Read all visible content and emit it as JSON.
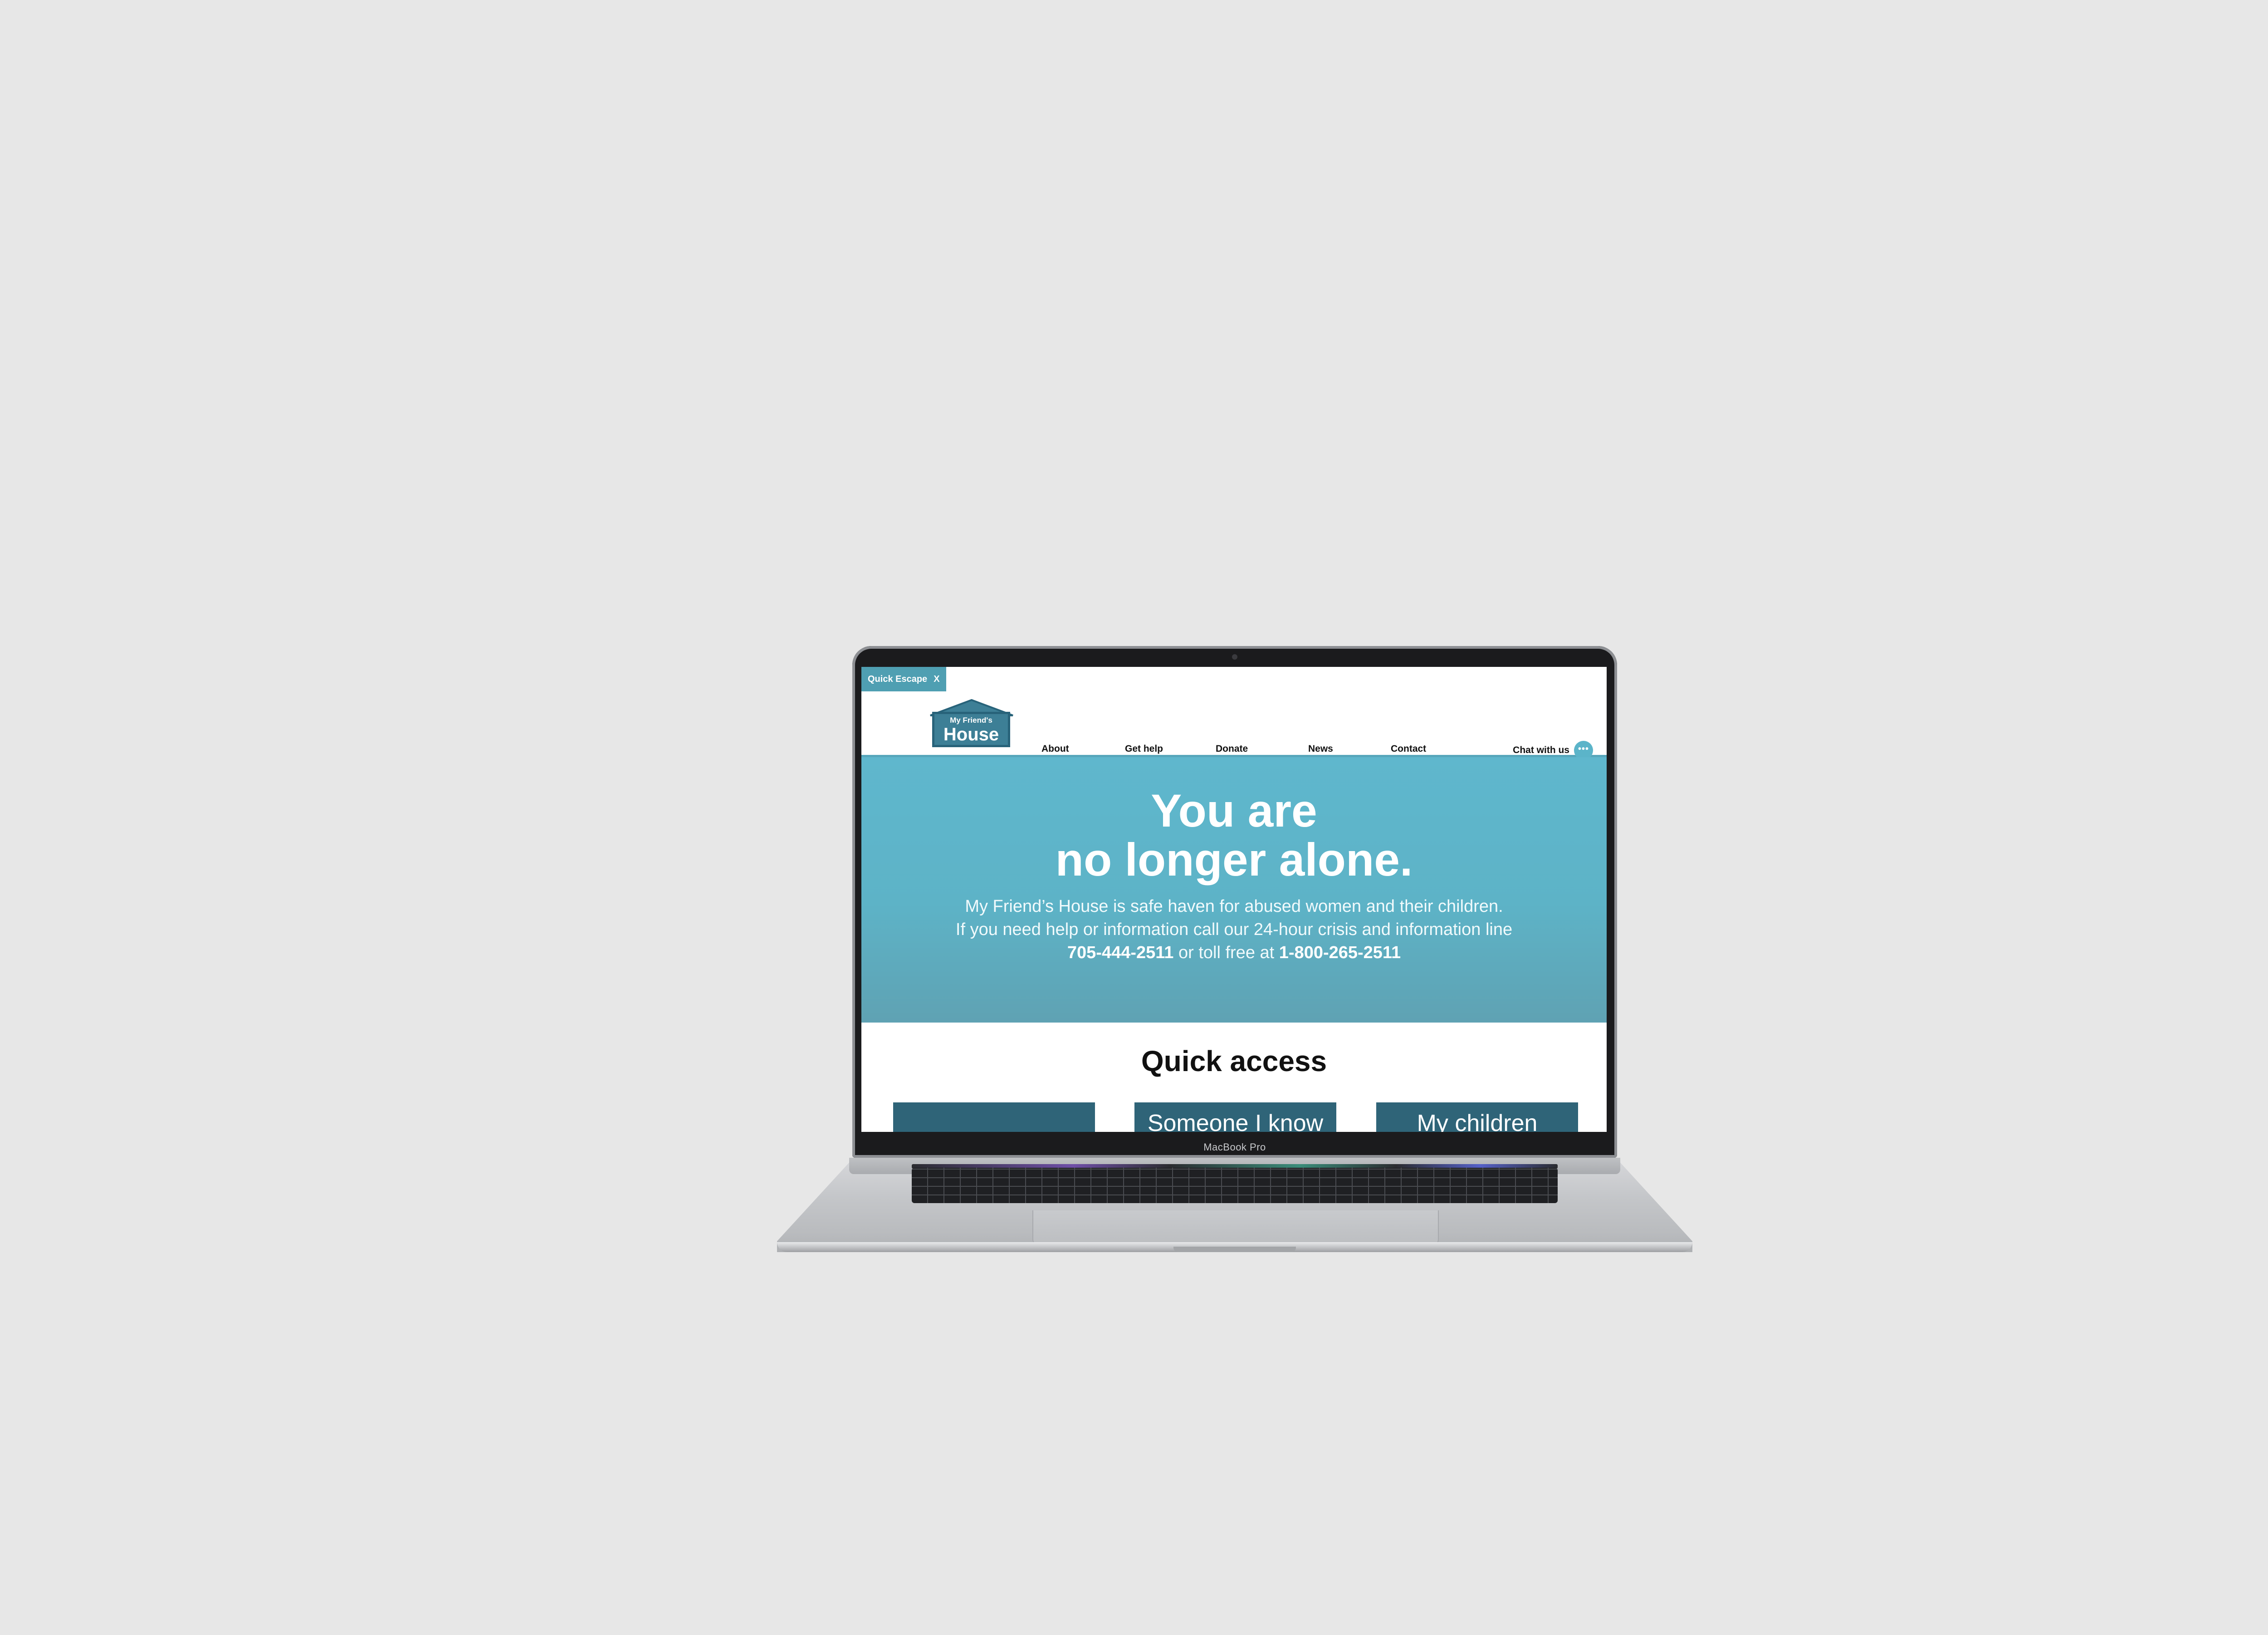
{
  "browser": {
    "quick_escape": {
      "label": "Quick Escape",
      "close": "X"
    }
  },
  "header": {
    "logo_top": "My Friend's",
    "logo_bottom": "House",
    "nav": [
      "About",
      "Get help",
      "Donate",
      "News",
      "Contact"
    ],
    "chat_label": "Chat with us",
    "chat_icon": "chat-bubble-icon"
  },
  "hero": {
    "title_line1": "You are",
    "title_line2": "no longer alone.",
    "line1": "My Friend’s House is safe haven for abused women and their children.",
    "line2": "If you need help or information call our 24-hour crisis and information line",
    "phone1": "705-444-2511",
    "phone_join": " or toll free at ",
    "phone2": "1-800-265-2511"
  },
  "quick_access": {
    "title": "Quick access",
    "cards": [
      "",
      "Someone I know",
      "My children"
    ]
  },
  "device": {
    "label": "MacBook Pro"
  },
  "colors": {
    "accent": "#5db3c7",
    "dark_teal": "#2f6478",
    "background": "#e7e7e7"
  }
}
